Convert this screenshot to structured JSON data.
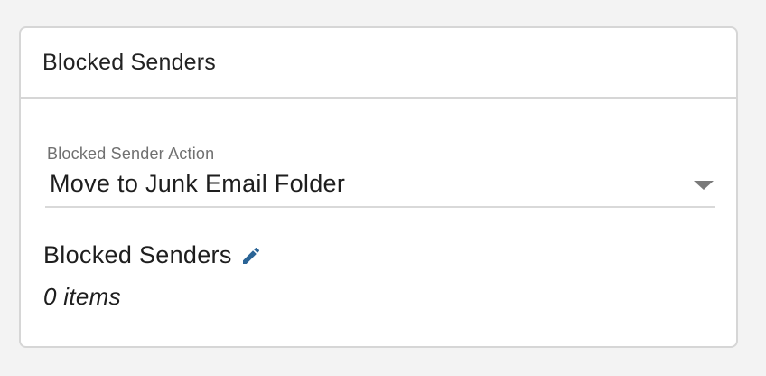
{
  "card": {
    "title": "Blocked Senders"
  },
  "action_select": {
    "label": "Blocked Sender Action",
    "value": "Move to Junk Email Folder",
    "icon": "chevron-down-icon"
  },
  "blocked_senders": {
    "label": "Blocked Senders",
    "edit_icon": "pencil-icon",
    "count_text": "0 items"
  },
  "colors": {
    "page_background": "#f3f3f3",
    "card_background": "#ffffff",
    "border": "#d6d6d6",
    "label_gray": "#707070",
    "accent_blue": "#2a6496"
  }
}
